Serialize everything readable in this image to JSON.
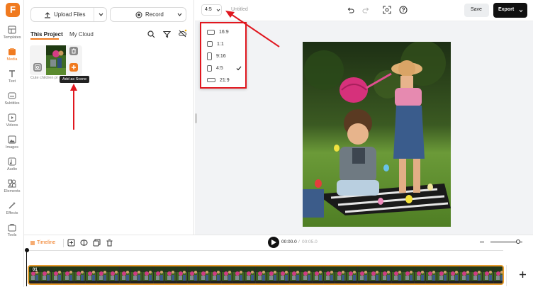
{
  "app": {
    "logo_letter": "F",
    "rail": [
      {
        "label": "Templates",
        "icon": "template-icon"
      },
      {
        "label": "Media",
        "icon": "media-icon"
      },
      {
        "label": "Text",
        "icon": "text-icon"
      },
      {
        "label": "Subtitles",
        "icon": "subtitles-icon"
      },
      {
        "label": "Videos",
        "icon": "video-icon"
      },
      {
        "label": "Images",
        "icon": "image-icon"
      },
      {
        "label": "Audio",
        "icon": "audio-icon"
      },
      {
        "label": "Elements",
        "icon": "elements-icon"
      },
      {
        "label": "Effects",
        "icon": "effects-icon"
      },
      {
        "label": "Tools",
        "icon": "tools-icon"
      }
    ]
  },
  "panel": {
    "upload_label": "Upload Files",
    "record_label": "Record",
    "tab_project": "This Project",
    "tab_cloud": "My Cloud",
    "media_caption": "Cute children pl",
    "tooltip": "Add as Scene"
  },
  "topbar": {
    "ratio": "4:5",
    "title": "Untitled",
    "save_label": "Save",
    "export_label": "Export"
  },
  "ratio_menu": {
    "options": [
      "16:9",
      "1:1",
      "9:16",
      "4:5",
      "21:9"
    ],
    "selected": "4:5"
  },
  "timeline": {
    "label": "Timeline",
    "current_time": "00:00.0",
    "total_time": "00:05.0",
    "clip_number": "01"
  },
  "colors": {
    "accent": "#f07a1f",
    "annotation": "#e0171f"
  }
}
